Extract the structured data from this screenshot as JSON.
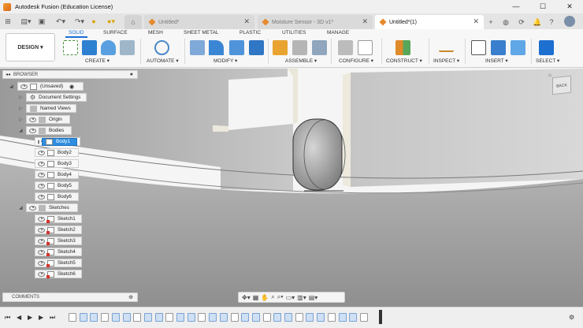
{
  "window": {
    "title": "Autodesk Fusion (Education License)"
  },
  "tabs": [
    {
      "label": "Untitled*",
      "active": false
    },
    {
      "label": "Moisture Sensor - 3D v1*",
      "active": false
    },
    {
      "label": "Untitled*(1)",
      "active": true
    }
  ],
  "ribbon": {
    "workspace": "DESIGN",
    "tabs": [
      "SOLID",
      "SURFACE",
      "MESH",
      "SHEET METAL",
      "PLASTIC",
      "UTILITIES",
      "MANAGE"
    ],
    "groups": [
      "CREATE",
      "AUTOMATE",
      "MODIFY",
      "ASSEMBLE",
      "CONFIGURE",
      "CONSTRUCT",
      "INSPECT",
      "INSERT",
      "SELECT"
    ]
  },
  "browser": {
    "title": "BROWSER",
    "root": "(Unsaved)",
    "items": [
      {
        "label": "Document Settings",
        "icon": "gear-icon"
      },
      {
        "label": "Named Views",
        "icon": "folder-icon"
      },
      {
        "label": "Origin",
        "icon": "folder-icon"
      },
      {
        "label": "Bodies",
        "icon": "folder-icon"
      },
      {
        "label": "Body1",
        "icon": "body-icon",
        "selected": true
      },
      {
        "label": "Body2",
        "icon": "body-icon"
      },
      {
        "label": "Body3",
        "icon": "body-icon"
      },
      {
        "label": "Body4",
        "icon": "body-icon"
      },
      {
        "label": "Body5",
        "icon": "body-icon"
      },
      {
        "label": "Body6",
        "icon": "body-icon"
      },
      {
        "label": "Sketches",
        "icon": "folder-icon"
      },
      {
        "label": "Sketch1",
        "icon": "sketch-icon"
      },
      {
        "label": "Sketch2",
        "icon": "sketch-icon"
      },
      {
        "label": "Sketch3",
        "icon": "sketch-icon"
      },
      {
        "label": "Sketch4",
        "icon": "sketch-icon"
      },
      {
        "label": "Sketch5",
        "icon": "sketch-icon"
      },
      {
        "label": "Sketch6",
        "icon": "sketch-icon"
      }
    ]
  },
  "comments": {
    "title": "COMMENTS"
  },
  "viewcube": {
    "face": "BACK"
  }
}
